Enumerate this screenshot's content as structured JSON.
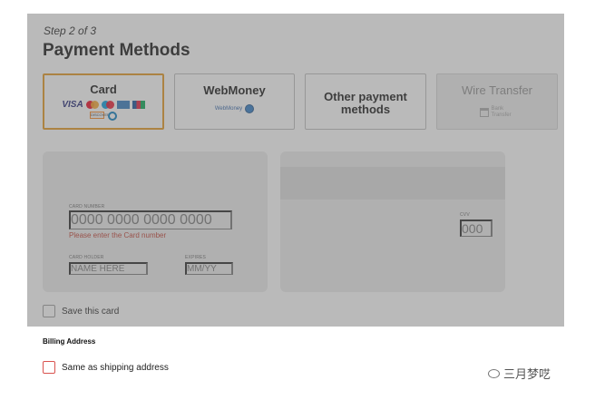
{
  "header": {
    "step": "Step 2 of 3",
    "title": "Payment Methods"
  },
  "methods": {
    "card": {
      "label": "Card",
      "logos": [
        "VISA",
        "mastercard",
        "maestro",
        "amex",
        "jcb",
        "DISCOVER",
        "diners"
      ]
    },
    "webmoney": {
      "label": "WebMoney",
      "logo_text": "WebMoney"
    },
    "other": {
      "label": "Other payment methods"
    },
    "wire": {
      "label": "Wire Transfer",
      "logo_text": "Bank Transfer"
    }
  },
  "card_form": {
    "number_label": "CARD NUMBER",
    "number_placeholder": "0000 0000 0000 0000",
    "number_error": "Please enter the Card number",
    "holder_label": "CARD HOLDER",
    "holder_placeholder": "NAME HERE",
    "expires_label": "EXPIRES",
    "expires_placeholder": "MM/YY",
    "cvv_label": "CVV",
    "cvv_placeholder": "000"
  },
  "save_card": {
    "label": "Save this card",
    "checked": false
  },
  "billing": {
    "heading": "Billing Address",
    "same_as_shipping": {
      "label": "Same as shipping address",
      "checked": false
    }
  },
  "watermark": {
    "text": "三月梦呓"
  },
  "colors": {
    "selected_border": "#e5961c",
    "error": "#c0392b",
    "overlay": "rgba(110,110,110,0.48)"
  }
}
